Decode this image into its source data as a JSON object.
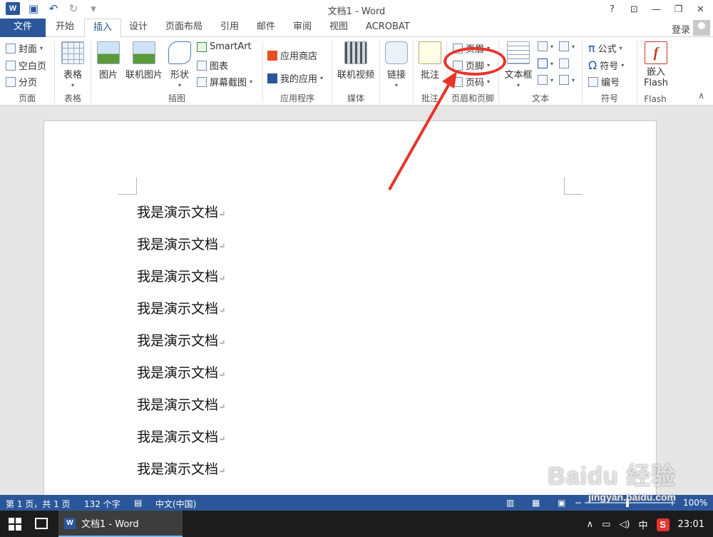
{
  "window": {
    "title": "文档1 - Word",
    "help": "?",
    "signin": "登录"
  },
  "tabs": [
    "文件",
    "开始",
    "插入",
    "设计",
    "页面布局",
    "引用",
    "邮件",
    "审阅",
    "视图",
    "ACROBAT"
  ],
  "ribbon": {
    "pages": {
      "cover": "封面",
      "blank": "空白页",
      "break": "分页",
      "label": "页面"
    },
    "tables": {
      "table": "表格",
      "label": "表格"
    },
    "illustrations": {
      "picture": "图片",
      "online_picture": "联机图片",
      "shapes": "形状",
      "smartart": "SmartArt",
      "chart": "图表",
      "screenshot": "屏幕截图",
      "label": "插图"
    },
    "apps": {
      "store": "应用商店",
      "myapps": "我的应用",
      "label": "应用程序"
    },
    "media": {
      "online_video": "联机视频",
      "label": "媒体"
    },
    "links": {
      "link": "链接"
    },
    "comments": {
      "comment": "批注",
      "label": "批注"
    },
    "header_footer": {
      "header": "页眉",
      "footer": "页脚",
      "page_number": "页码",
      "label": "页眉和页脚"
    },
    "text": {
      "textbox": "文本框",
      "label": "文本"
    },
    "symbols": {
      "equation": "公式",
      "symbol": "符号",
      "number": "编号",
      "label": "符号"
    },
    "flash": {
      "embed": "嵌入",
      "flash": "Flash",
      "label": "Flash"
    }
  },
  "document": {
    "lines": [
      "我是演示文档",
      "我是演示文档",
      "我是演示文档",
      "我是演示文档",
      "我是演示文档",
      "我是演示文档",
      "我是演示文档",
      "我是演示文档",
      "我是演示文档"
    ]
  },
  "status": {
    "page": "第 1 页，共 1 页",
    "words": "132 个字",
    "lang": "中文(中国)",
    "zoom": "100%"
  },
  "taskbar": {
    "app": "文档1 - Word",
    "ime": "中",
    "time": "23:01"
  },
  "watermark": {
    "brand": "Baidu 经验",
    "url": "jingyan.baidu.com"
  },
  "colors": {
    "word_blue": "#2b579a",
    "annotation_red": "#e8342b"
  }
}
